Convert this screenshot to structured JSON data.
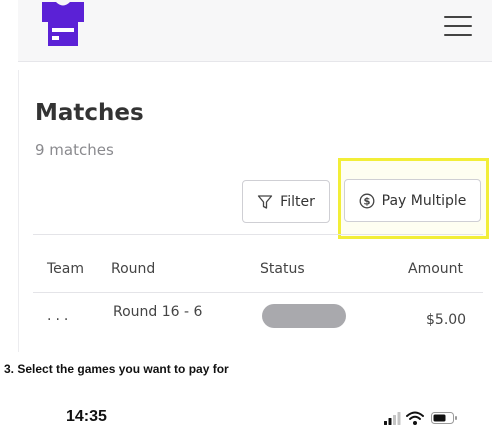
{
  "header": {
    "logo_icon": "shirt-logo-icon",
    "menu_icon": "hamburger-menu-icon",
    "brand_color": "#5b21d6"
  },
  "page": {
    "title": "Matches",
    "subtitle": "9 matches"
  },
  "toolbar": {
    "filter_label": "Filter",
    "filter_icon": "funnel-icon",
    "pay_multiple_label": "Pay Multiple",
    "pay_multiple_icon": "dollar-circle-icon",
    "highlight_color": "#f2ee38"
  },
  "table": {
    "columns": [
      "Team",
      "Round",
      "Status",
      "Amount"
    ],
    "rows": [
      {
        "team": "...",
        "round": "Round 16  - 6",
        "status": "",
        "amount": "$5.00"
      }
    ]
  },
  "caption": "3. Select the games you want to pay for",
  "statusbar": {
    "time": "14:35",
    "icons": [
      "signal-icon",
      "wifi-icon",
      "battery-icon"
    ]
  }
}
